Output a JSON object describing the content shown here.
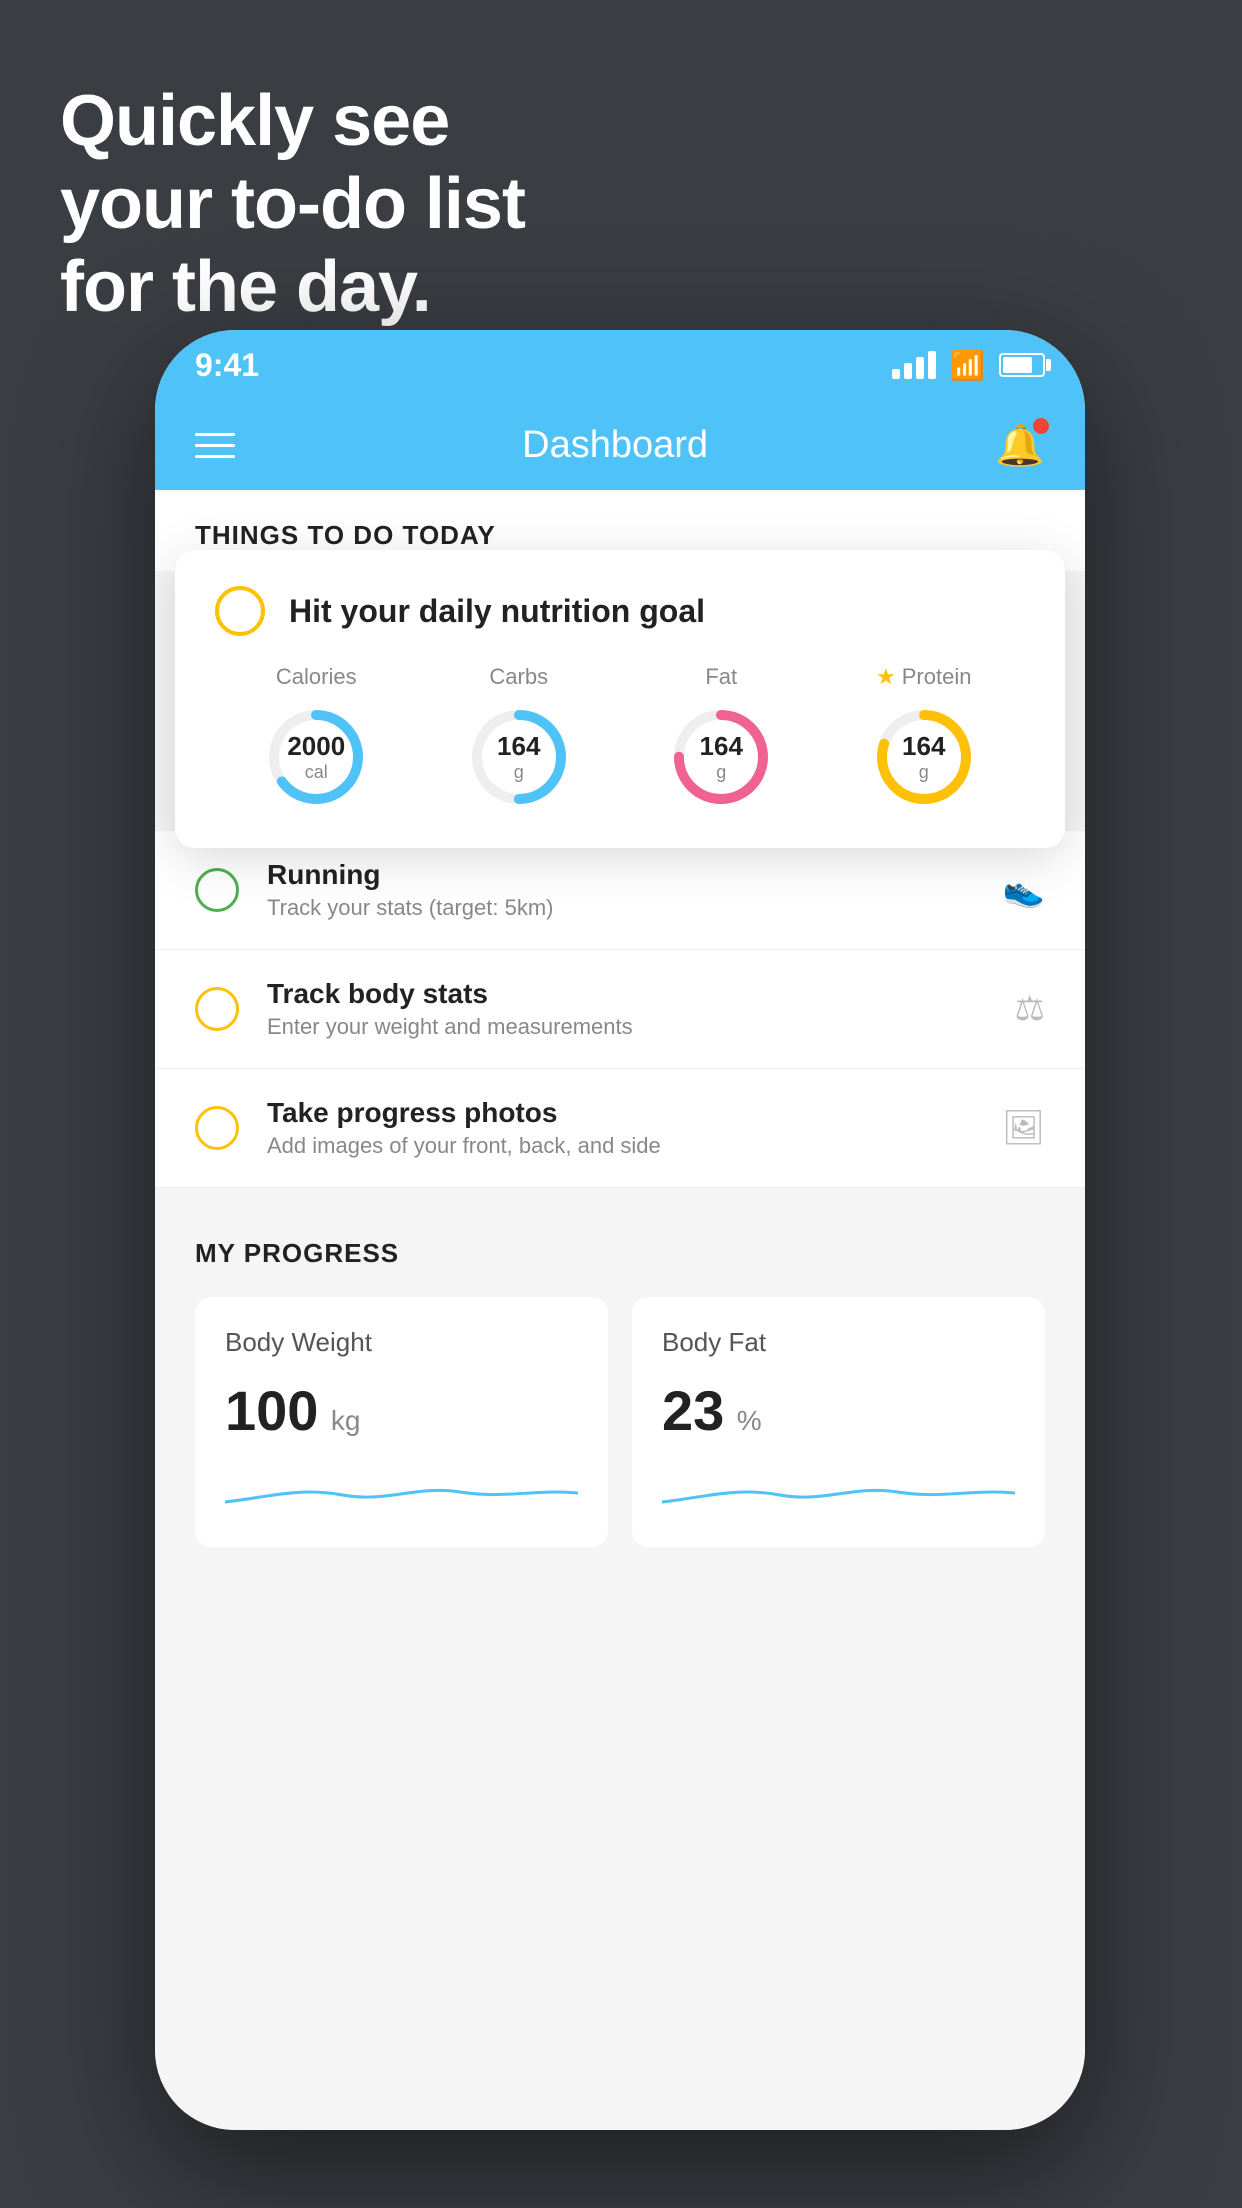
{
  "hero": {
    "line1": "Quickly see",
    "line2": "your to-do list",
    "line3": "for the day."
  },
  "status_bar": {
    "time": "9:41"
  },
  "nav": {
    "title": "Dashboard"
  },
  "things_section": {
    "title": "THINGS TO DO TODAY"
  },
  "nutrition_card": {
    "title": "Hit your daily nutrition goal",
    "metrics": [
      {
        "label": "Calories",
        "value": "2000",
        "unit": "cal",
        "color": "#4fc3f7",
        "pct": 65
      },
      {
        "label": "Carbs",
        "value": "164",
        "unit": "g",
        "color": "#4fc3f7",
        "pct": 50
      },
      {
        "label": "Fat",
        "value": "164",
        "unit": "g",
        "color": "#f06292",
        "pct": 75
      },
      {
        "label": "Protein",
        "value": "164",
        "unit": "g",
        "color": "#ffc107",
        "pct": 80,
        "star": true
      }
    ]
  },
  "todo_items": [
    {
      "name": "Running",
      "sub": "Track your stats (target: 5km)",
      "circle_color": "green",
      "icon": "👟"
    },
    {
      "name": "Track body stats",
      "sub": "Enter your weight and measurements",
      "circle_color": "yellow",
      "icon": "⚖"
    },
    {
      "name": "Take progress photos",
      "sub": "Add images of your front, back, and side",
      "circle_color": "yellow",
      "icon": "🖼"
    }
  ],
  "progress": {
    "title": "MY PROGRESS",
    "cards": [
      {
        "title": "Body Weight",
        "value": "100",
        "unit": "kg"
      },
      {
        "title": "Body Fat",
        "value": "23",
        "unit": "%"
      }
    ]
  }
}
